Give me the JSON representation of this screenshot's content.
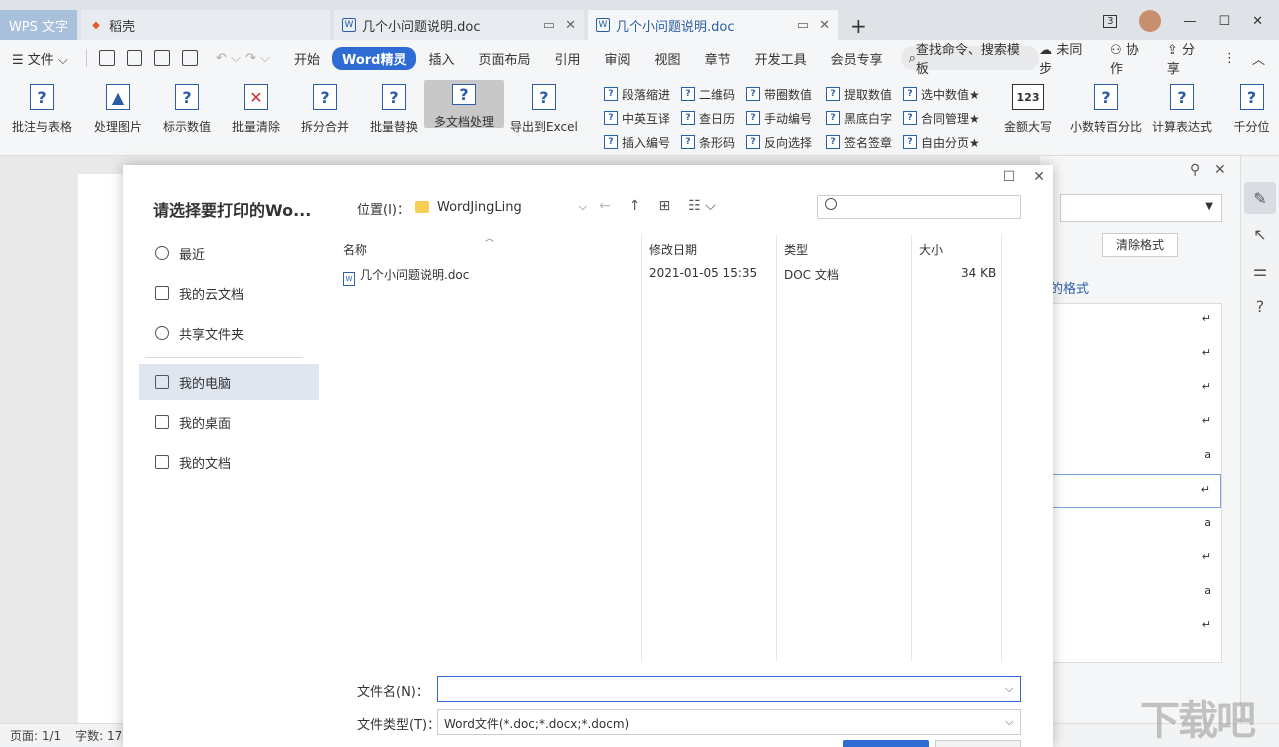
{
  "tabs": {
    "wps": "WPS 文字",
    "daoke": "稻壳",
    "doc1": "几个小问题说明.doc",
    "doc2": "几个小问题说明.doc",
    "new_tab": "+"
  },
  "window": {
    "badge": "3"
  },
  "menubar": {
    "file": "文件",
    "items": [
      "开始",
      "Word精灵",
      "插入",
      "页面布局",
      "引用",
      "审阅",
      "视图",
      "章节",
      "开发工具",
      "会员专享"
    ],
    "search": "查找命令、搜索模板",
    "right": [
      "未同步",
      "协作",
      "分享"
    ]
  },
  "ribbon": {
    "big": [
      "批注与表格",
      "处理图片",
      "标示数值",
      "批量清除",
      "拆分合并",
      "批量替换",
      "多文档处理",
      "导出到Excel"
    ],
    "col1": [
      "段落缩进",
      "中英互译",
      "插入编号"
    ],
    "col2": [
      "二维码",
      "查日历",
      "条形码"
    ],
    "col3": [
      "带圈数值",
      "手动编号",
      "反向选择"
    ],
    "col4": [
      "提取数值",
      "黑底白字",
      "签名签章"
    ],
    "col5": [
      "选中数值★",
      "合同管理★",
      "自由分页★"
    ],
    "big_right": [
      "金额大写",
      "小数转百分比",
      "计算表达式",
      "千分位"
    ],
    "amount_icon": "123"
  },
  "sidepanel": {
    "clear_format": "清除格式",
    "link": "的格式",
    "rows": [
      "↵",
      "↵",
      "↵",
      "↵",
      "a",
      "↵",
      "a",
      "↵",
      "a",
      "↵",
      "↵"
    ]
  },
  "statusbar": {
    "page": "页面: 1/1",
    "words": "字数: 17"
  },
  "dialog": {
    "title": "请选择要打印的Wo...",
    "nav": [
      "最近",
      "我的云文档",
      "共享文件夹",
      "我的电脑",
      "我的桌面",
      "我的文档"
    ],
    "location_label": "位置(I)：",
    "location_value": "WordJingLing",
    "columns": {
      "name": "名称",
      "date": "修改日期",
      "type": "类型",
      "size": "大小"
    },
    "files": [
      {
        "name": "几个小问题说明.doc",
        "date": "2021-01-05 15:35",
        "type": "DOC 文档",
        "size": "34 KB"
      }
    ],
    "filename_label": "文件名(N)：",
    "filename_value": "",
    "filetype_label": "文件类型(T)：",
    "filetype_value": "Word文件(*.doc;*.docx;*.docm)"
  }
}
